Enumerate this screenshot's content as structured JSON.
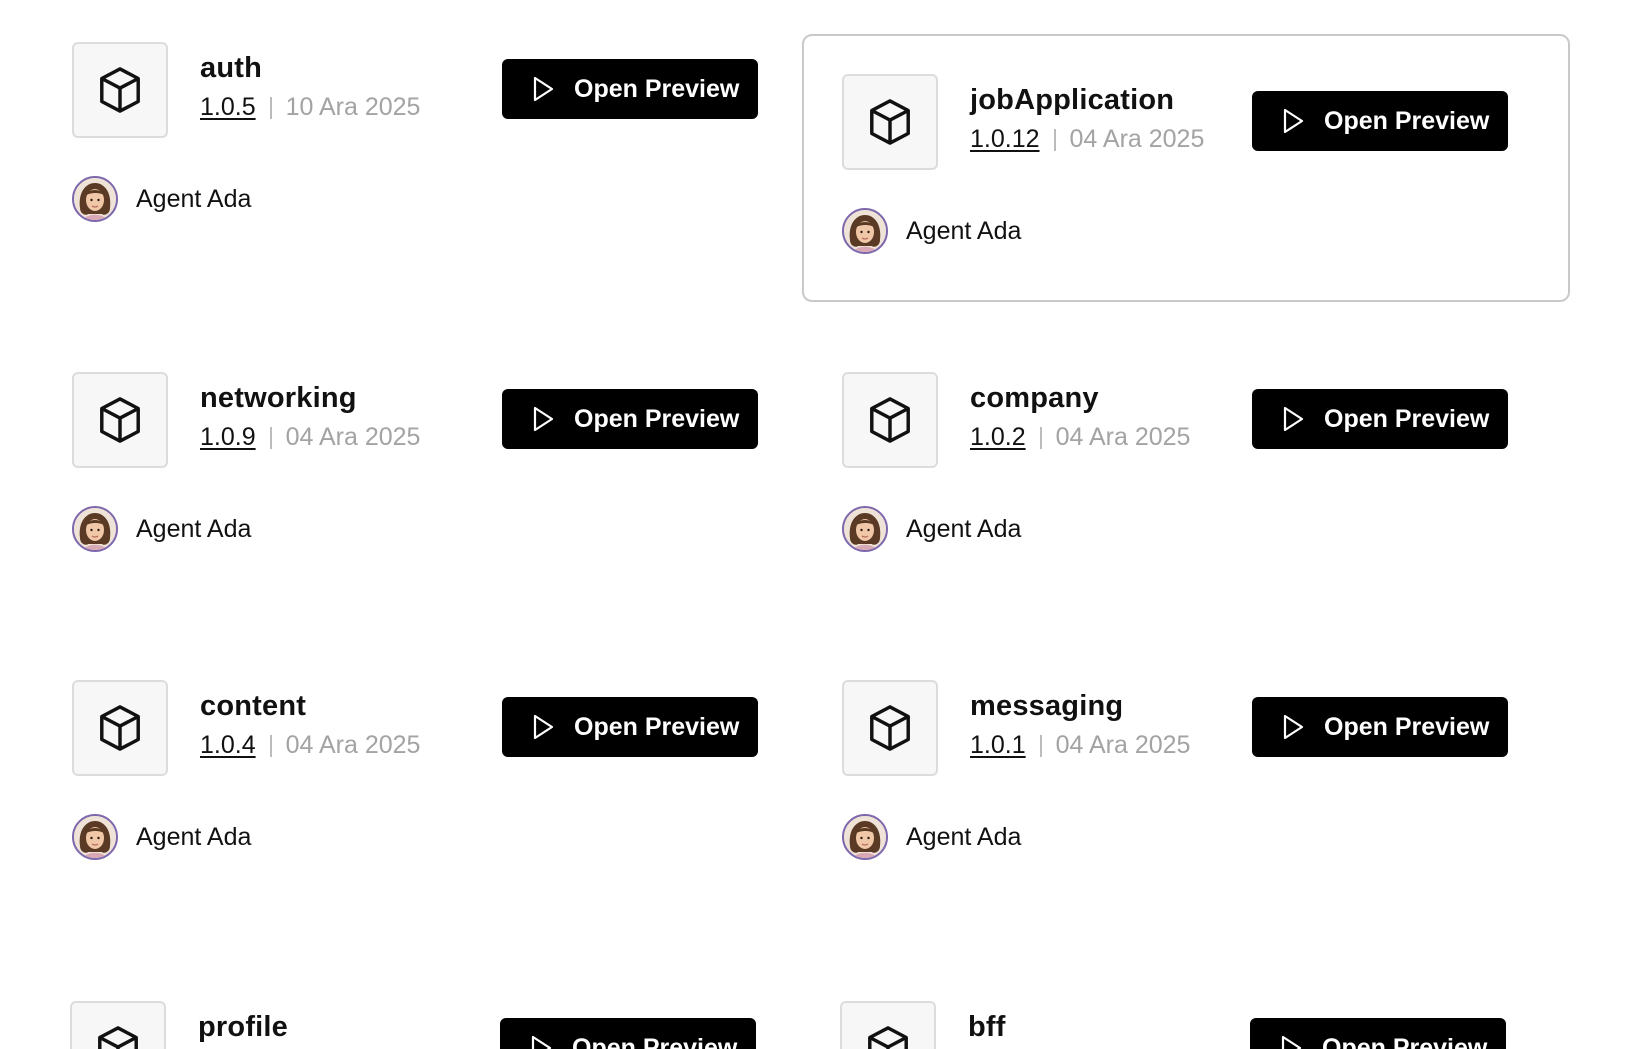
{
  "button_label": "Open Preview",
  "colors": {
    "button_bg": "#000000",
    "button_text": "#ffffff",
    "date_text": "#a3a3a3",
    "selected_border": "#c9c9c9",
    "avatar_ring": "#7d67ad"
  },
  "icons": {
    "package": "cube-icon",
    "play": "play-icon",
    "avatar": "agent-avatar"
  },
  "packages": [
    {
      "name": "auth",
      "version": "1.0.5",
      "date": "10 Ara 2025",
      "author": "Agent Ada",
      "selected": false
    },
    {
      "name": "jobApplication",
      "version": "1.0.12",
      "date": "04 Ara 2025",
      "author": "Agent Ada",
      "selected": true
    },
    {
      "name": "networking",
      "version": "1.0.9",
      "date": "04 Ara 2025",
      "author": "Agent Ada",
      "selected": false
    },
    {
      "name": "company",
      "version": "1.0.2",
      "date": "04 Ara 2025",
      "author": "Agent Ada",
      "selected": false
    },
    {
      "name": "content",
      "version": "1.0.4",
      "date": "04 Ara 2025",
      "author": "Agent Ada",
      "selected": false
    },
    {
      "name": "messaging",
      "version": "1.0.1",
      "date": "04 Ara 2025",
      "author": "Agent Ada",
      "selected": false
    },
    {
      "name": "profile",
      "version": "",
      "date": "",
      "author": "",
      "selected": false
    },
    {
      "name": "bff",
      "version": "",
      "date": "",
      "author": "",
      "selected": false
    }
  ]
}
